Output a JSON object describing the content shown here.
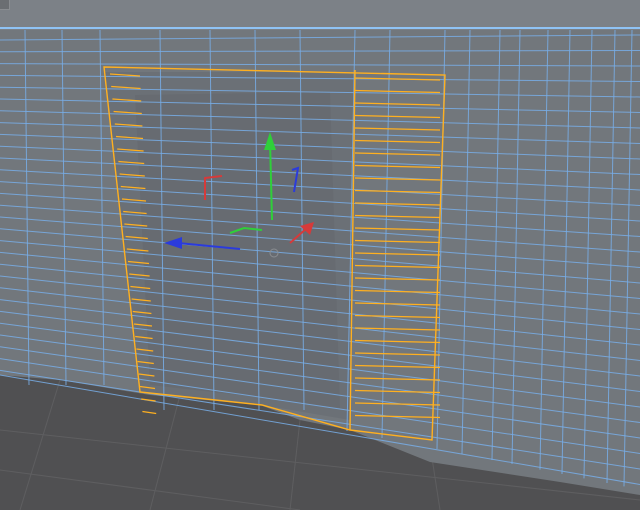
{
  "viewport": {
    "name": "3d-viewport",
    "wireframe_color": "#79aee6",
    "selection_color": "#ffb020",
    "surface_color": "#71767b",
    "floor_color": "#4f4f50",
    "gizmo": {
      "x_axis_color": "#d63a3a",
      "y_axis_color": "#2fcf3a",
      "z_axis_color": "#2b3bdc"
    }
  }
}
